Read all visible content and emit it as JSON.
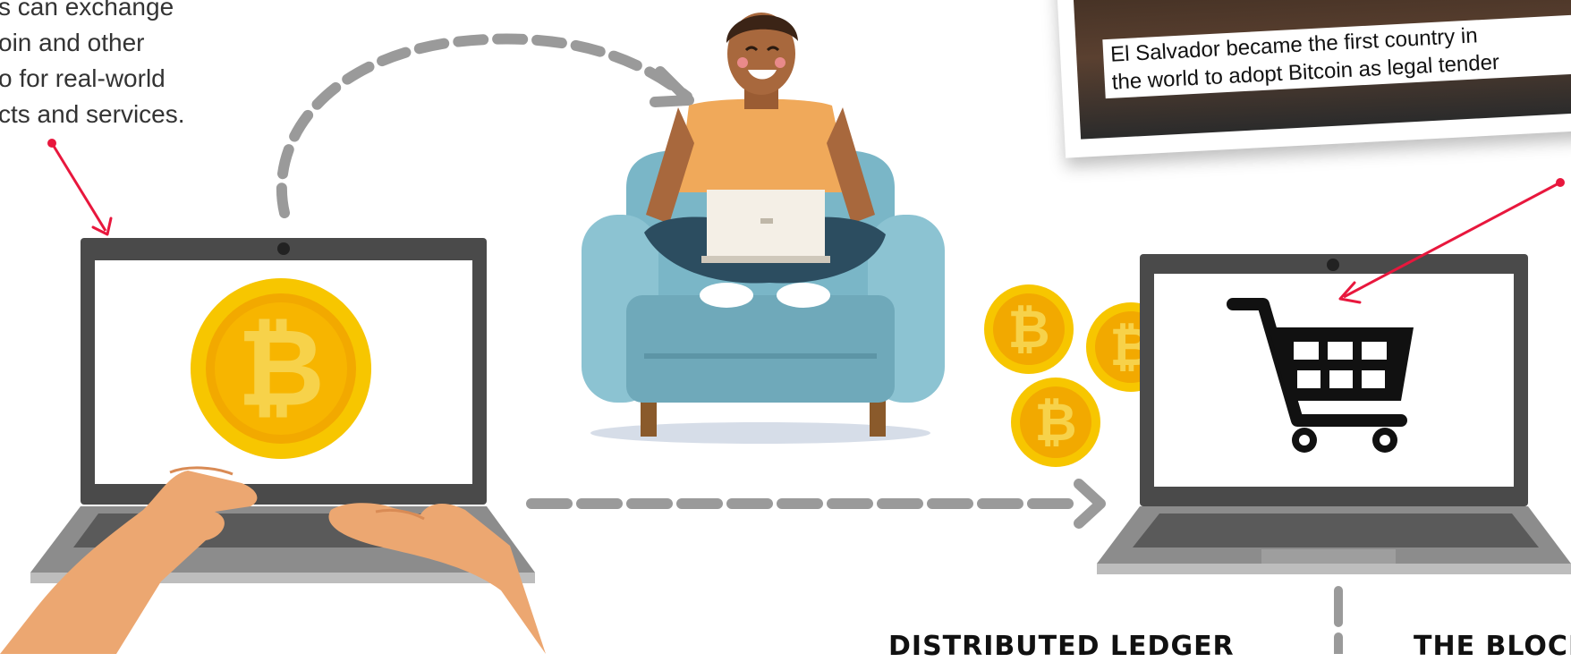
{
  "intro_lines": [
    "s can exchange",
    "oin and other",
    "o for real-world",
    "cts and services."
  ],
  "news_photo": {
    "caption_lines": [
      "El Salvador became the first country in",
      "the world to adopt Bitcoin as legal tender"
    ]
  },
  "sections": {
    "left_heading": "DISTRIBUTED LEDGER",
    "right_heading": "THE BLOCK"
  },
  "icons": {
    "coin": "bitcoin-icon",
    "cart": "shopping-cart-icon"
  },
  "colors": {
    "accent_pointer": "#e8173d",
    "coin_gold": "#f7c600",
    "coin_inner": "#f2a900",
    "armchair": "#7ab6c7",
    "shirt": "#f0a95a",
    "skin": "#a8683d",
    "arrow_gray": "#9a9a9a",
    "laptop_frame": "#4a4a4a"
  }
}
